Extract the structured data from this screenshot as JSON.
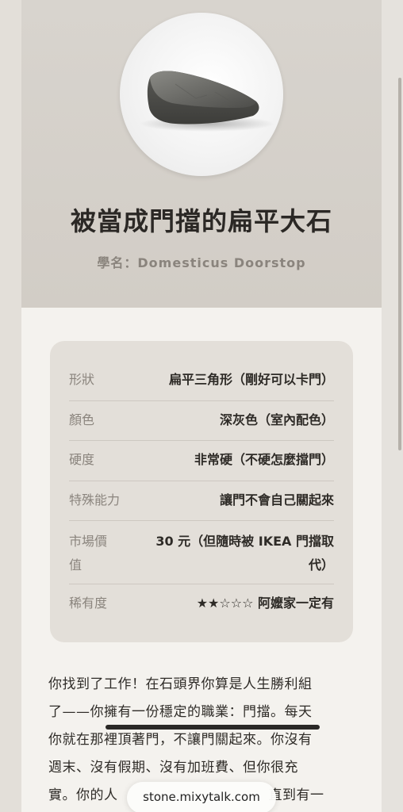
{
  "profile": {
    "title": "被當成門擋的扁平大石",
    "scientific_name": "學名：Domesticus Doorstop"
  },
  "attributes": [
    {
      "key": "形狀",
      "value": "扁平三角形（剛好可以卡門）"
    },
    {
      "key": "顏色",
      "value": "深灰色（室內配色）"
    },
    {
      "key": "硬度",
      "value": "非常硬（不硬怎麼擋門）"
    },
    {
      "key": "特殊能力",
      "value": "讓門不會自己關起來"
    },
    {
      "key": "市場價值",
      "key_line1": "市場價",
      "key_line2": "值",
      "value_line1": "30 元（但隨時被 IKEA 門擋取",
      "value_line2": "代）"
    },
    {
      "key": "稀有度",
      "value": "★★☆☆☆ 阿嬤家一定有"
    }
  ],
  "story": {
    "lines": [
      "你找到了工作！在石頭界你算是人生勝利組",
      "了——你擁有一份穩定的職業：門擋。每天",
      "你就在那裡頂著門，不讓門關起來。你沒有",
      "週末、沒有假期、沒有加班費、但你很充",
      "實。你的人",
      "直到有一"
    ]
  },
  "browser": {
    "url": "stone.mixytalk.com"
  },
  "colors": {
    "background": "#f4f2ee",
    "hero": "#d4cfc8",
    "card": "#e3dfd9"
  }
}
